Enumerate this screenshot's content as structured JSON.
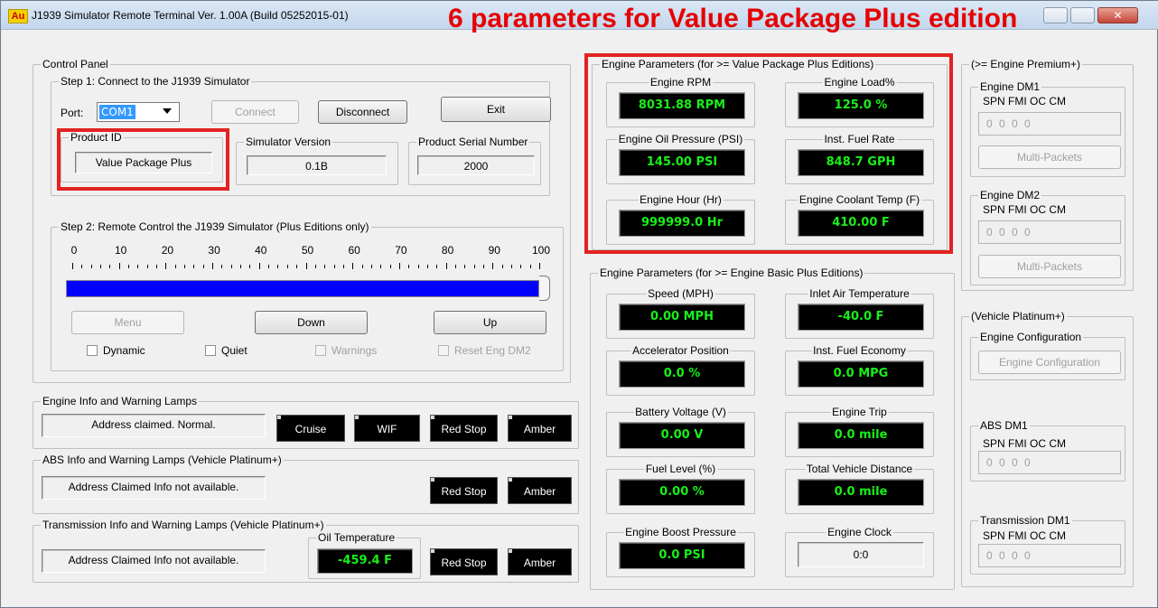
{
  "window": {
    "title": "J1939 Simulator Remote Terminal Ver. 1.00A (Build 05252015-01)",
    "app_icon_text": "Au",
    "close_glyph": "✕"
  },
  "annotation": "6 parameters for Value Package Plus edition",
  "control_panel": {
    "title": "Control Panel",
    "step1": {
      "title": "Step 1: Connect to the J1939 Simulator",
      "port_label": "Port:",
      "port_value": "COM1",
      "connect_label": "Connect",
      "disconnect_label": "Disconnect",
      "exit_label": "Exit",
      "product_id_title": "Product ID",
      "product_id_value": "Value Package Plus",
      "sim_version_title": "Simulator Version",
      "sim_version_value": "0.1B",
      "serial_title": "Product Serial Number",
      "serial_value": "2000"
    },
    "step2": {
      "title": "Step 2: Remote Control the J1939 Simulator (Plus Editions only)",
      "scale_labels": [
        "0",
        "10",
        "20",
        "30",
        "40",
        "50",
        "60",
        "70",
        "80",
        "90",
        "100"
      ],
      "slider_level_percent": 100,
      "menu_label": "Menu",
      "down_label": "Down",
      "up_label": "Up",
      "dynamic_label": "Dynamic",
      "quiet_label": "Quiet",
      "warnings_label": "Warnings",
      "reset_label": "Reset Eng DM2"
    }
  },
  "engine_info": {
    "title": "Engine Info and Warning Lamps",
    "status": "Address claimed. Normal.",
    "lamps": [
      "Cruise",
      "WIF",
      "Red Stop",
      "Amber"
    ]
  },
  "abs_info": {
    "title": "ABS Info and Warning Lamps (Vehicle Platinum+)",
    "status": "Address Claimed Info not available.",
    "lamps": [
      "Red Stop",
      "Amber"
    ]
  },
  "trans_info": {
    "title": "Transmission Info and Warning Lamps (Vehicle Platinum+)",
    "status": "Address Claimed Info not available.",
    "oil_temp_title": "Oil Temperature",
    "oil_temp_value": "-459.4 F",
    "lamps": [
      "Red Stop",
      "Amber"
    ]
  },
  "vpp_params": {
    "title": "Engine Parameters (for >= Value Package Plus Editions)",
    "items": [
      {
        "label": "Engine RPM",
        "value": "8031.88 RPM"
      },
      {
        "label": "Engine Load%",
        "value": "125.0 %"
      },
      {
        "label": "Engine Oil Pressure (PSI)",
        "value": "145.00 PSI"
      },
      {
        "label": "Inst. Fuel Rate",
        "value": "848.7 GPH"
      },
      {
        "label": "Engine Hour (Hr)",
        "value": "999999.0 Hr"
      },
      {
        "label": "Engine Coolant Temp (F)",
        "value": "410.00 F"
      }
    ]
  },
  "ebp_params": {
    "title": "Engine Parameters (for >= Engine Basic Plus Editions)",
    "items": [
      {
        "label": "Speed (MPH)",
        "value": "0.00 MPH"
      },
      {
        "label": "Inlet Air Temperature",
        "value": "-40.0 F"
      },
      {
        "label": "Accelerator Position",
        "value": "0.0 %"
      },
      {
        "label": "Inst. Fuel Economy",
        "value": "0.0 MPG"
      },
      {
        "label": "Battery Voltage (V)",
        "value": "0.00 V"
      },
      {
        "label": "Engine Trip",
        "value": "0.0 mile"
      },
      {
        "label": "Fuel Level (%)",
        "value": "0.00 %"
      },
      {
        "label": "Total Vehicle Distance",
        "value": "0.0 mile"
      },
      {
        "label": "Engine Boost Pressure",
        "value": "0.0 PSI"
      },
      {
        "label": "Engine Clock",
        "value": "0:0"
      }
    ]
  },
  "premium": {
    "title": "(>= Engine Premium+)",
    "dm1_title": "Engine DM1",
    "dm2_title": "Engine DM2",
    "header": "SPN  FMI  OC  CM",
    "values": "0  0  0  0",
    "multi_label": "Multi-Packets"
  },
  "platinum": {
    "title": "(Vehicle Platinum+)",
    "engine_config_title": "Engine Configuration",
    "engine_config_button": "Engine Configuration",
    "abs_dm1_title": "ABS DM1",
    "trans_dm1_title": "Transmission DM1",
    "header": "SPN  FMI  OC  CM",
    "values": "0  0  0  0"
  },
  "colors": {
    "annotation": "#e60000",
    "lcd_text": "#18f018",
    "slider_fill": "#0000ff"
  }
}
